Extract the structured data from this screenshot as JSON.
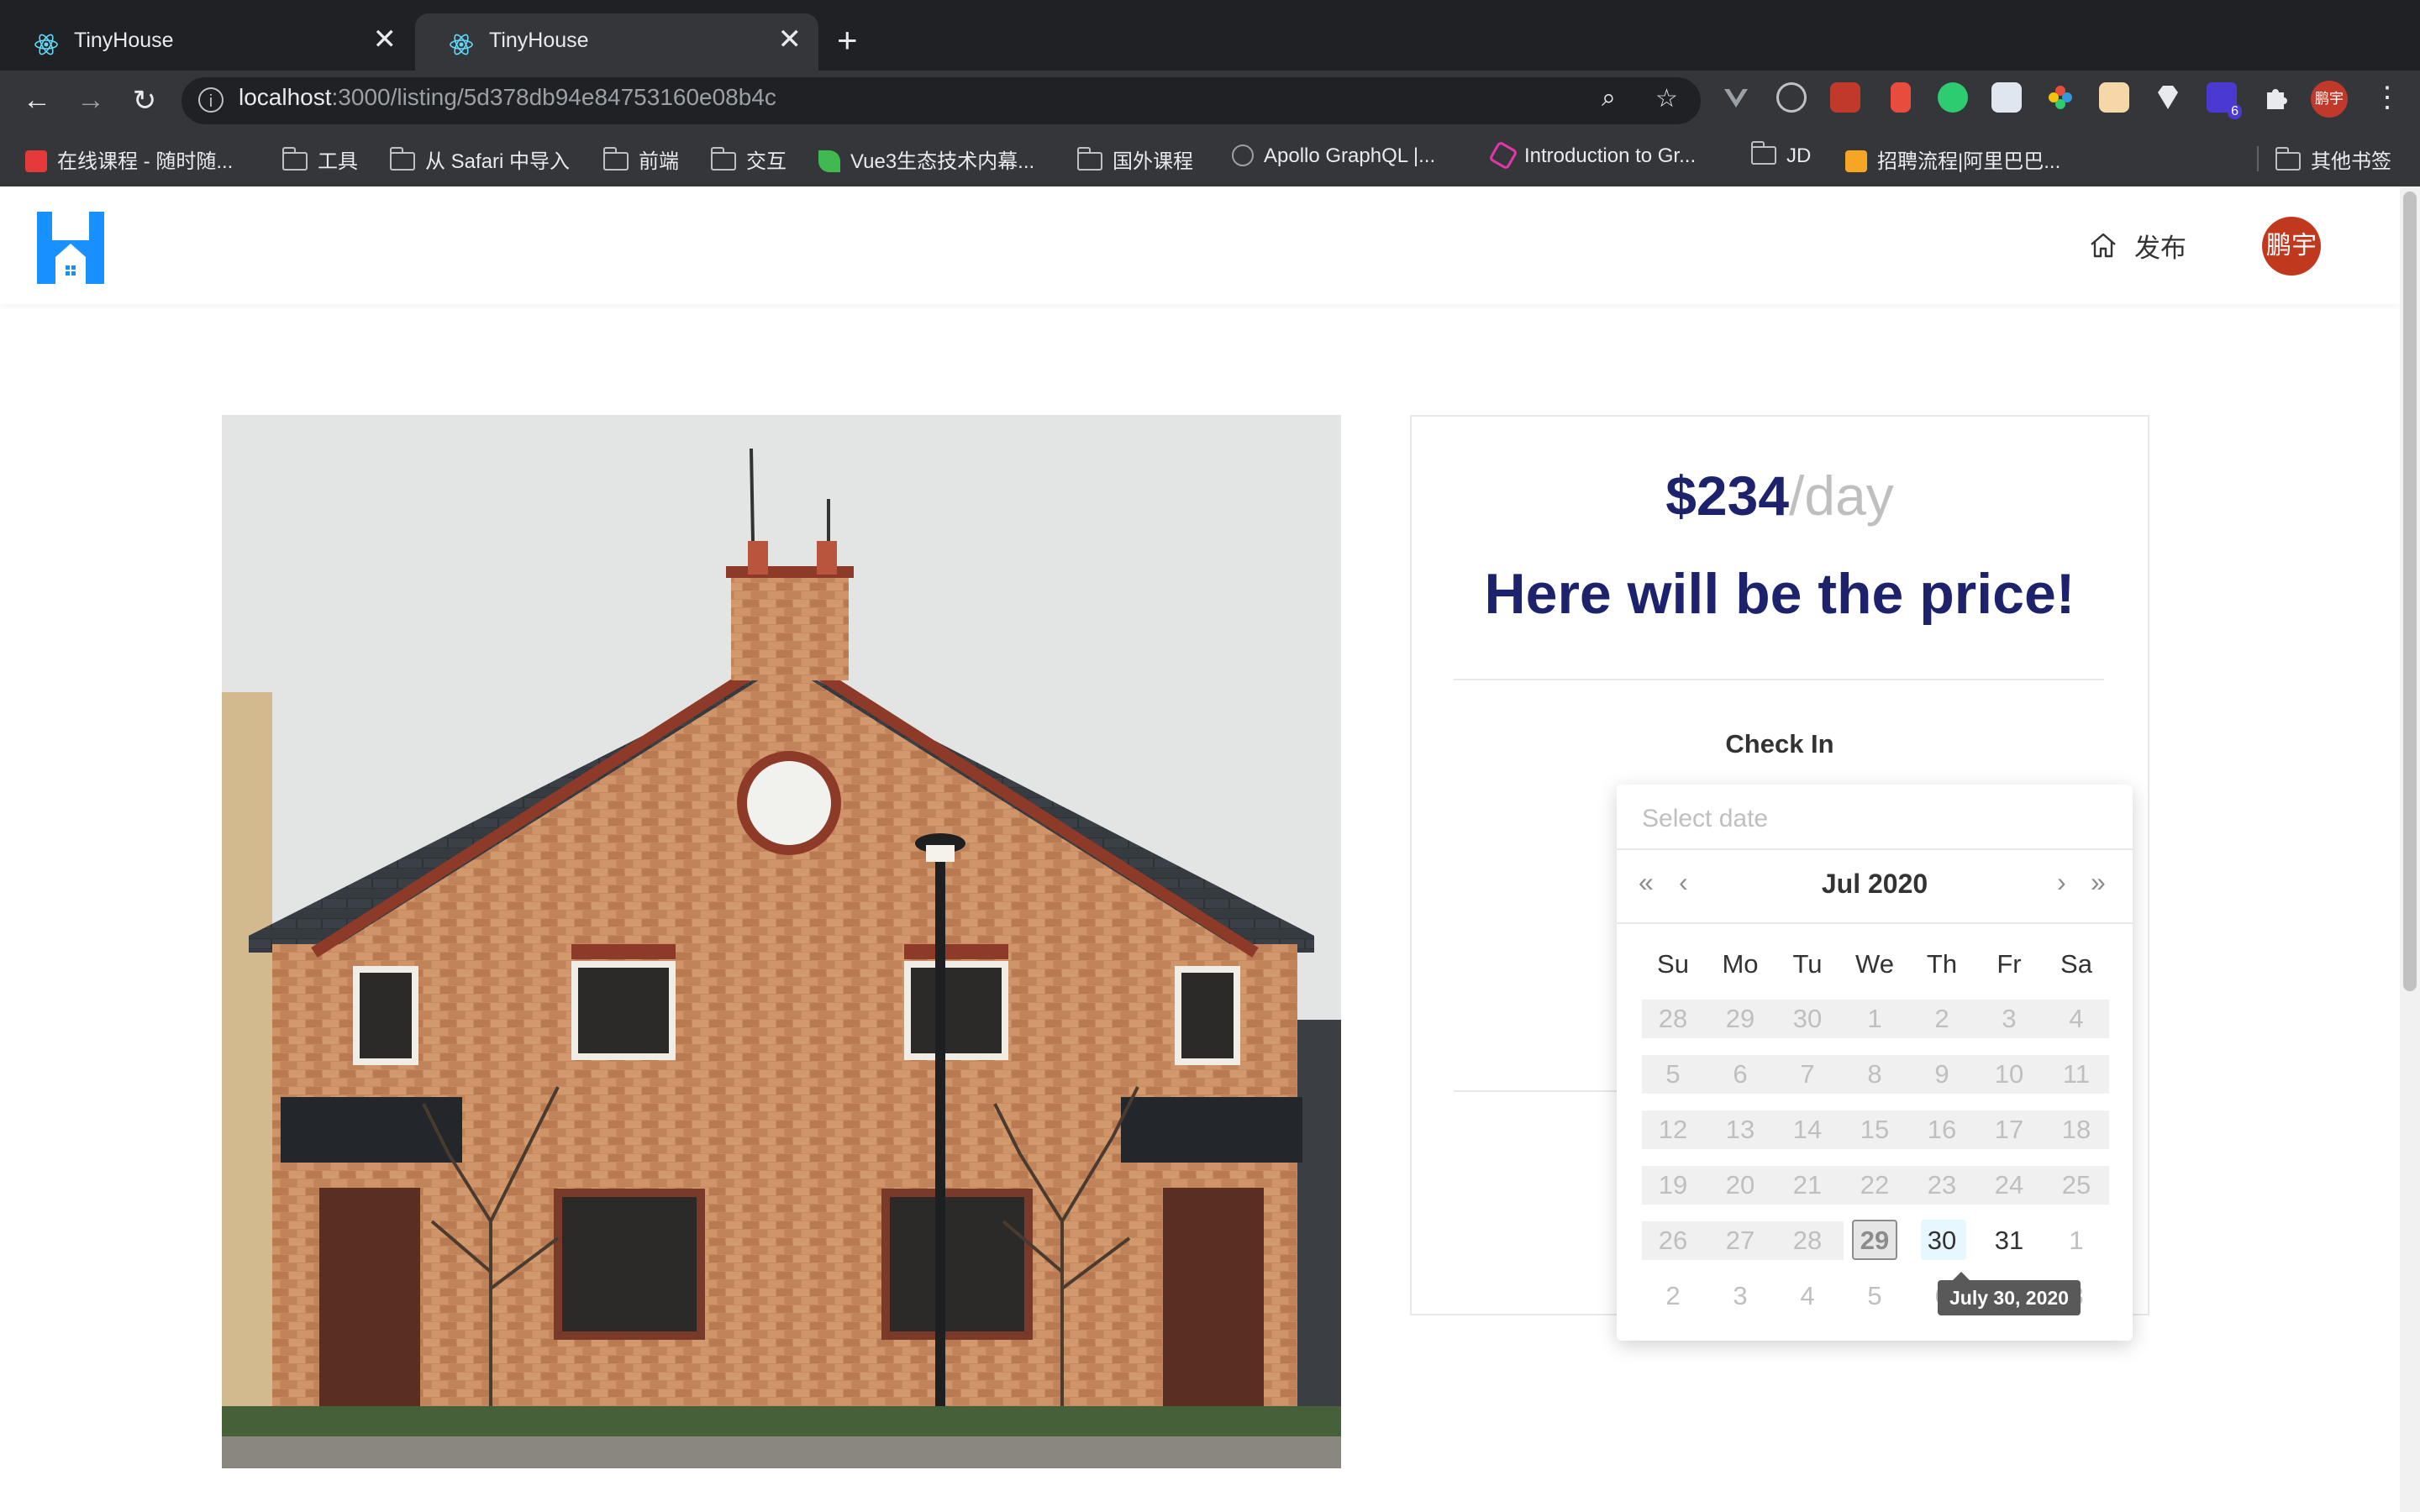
{
  "browser": {
    "tabs": [
      {
        "title": "TinyHouse",
        "close": "✕"
      },
      {
        "title": "TinyHouse",
        "close": "✕"
      }
    ],
    "new_tab": "+",
    "nav": {
      "back": "←",
      "forward": "→",
      "reload": "↻"
    },
    "url": {
      "host": "localhost",
      "rest": ":3000/listing/5d378db94e84753160e08b4c"
    },
    "url_info_icon": "i",
    "zoom_icon": "⌕",
    "star_icon": "☆",
    "profile_initials": "鹏宇",
    "menu": "⋮",
    "extension_badge": "6",
    "bookmarks": [
      {
        "label": "在线课程 - 随时随...",
        "icon": "brand-icon",
        "color": "#e5393a"
      },
      {
        "label": "工具",
        "icon": "folder-icon"
      },
      {
        "label": "从 Safari 中导入",
        "icon": "folder-icon"
      },
      {
        "label": "前端",
        "icon": "folder-icon"
      },
      {
        "label": "交互",
        "icon": "folder-icon"
      },
      {
        "label": "Vue3生态技术内幕...",
        "icon": "leaf-icon",
        "color": "#3fb950"
      },
      {
        "label": "国外课程",
        "icon": "folder-icon"
      },
      {
        "label": "Apollo GraphQL |...",
        "icon": "apollo-icon",
        "color": "#3c4a6b"
      },
      {
        "label": "Introduction to Gr...",
        "icon": "graphql-icon",
        "color": "#e535ab"
      },
      {
        "label": "JD",
        "icon": "folder-icon"
      },
      {
        "label": "招聘流程|阿里巴巴...",
        "icon": "alibaba-icon",
        "color": "#f5a623"
      },
      {
        "label": "其他书签",
        "icon": "folder-icon"
      }
    ]
  },
  "app": {
    "header": {
      "host_label": "发布",
      "avatar_text": "鹏宇"
    },
    "booking": {
      "price": "$234",
      "per": "/day",
      "price_title": "Here will be the price!",
      "check_in_label": "Check In"
    },
    "datepicker": {
      "placeholder": "Select date",
      "month_label": "Jul 2020",
      "prev_year": "«",
      "prev_month": "‹",
      "next_month": "›",
      "next_year": "»",
      "weekdays": [
        "Su",
        "Mo",
        "Tu",
        "We",
        "Th",
        "Fr",
        "Sa"
      ],
      "weeks": [
        [
          "28",
          "29",
          "30",
          "1",
          "2",
          "3",
          "4"
        ],
        [
          "5",
          "6",
          "7",
          "8",
          "9",
          "10",
          "11"
        ],
        [
          "12",
          "13",
          "14",
          "15",
          "16",
          "17",
          "18"
        ],
        [
          "19",
          "20",
          "21",
          "22",
          "23",
          "24",
          "25"
        ],
        [
          "26",
          "27",
          "28",
          "29",
          "30",
          "31",
          "1"
        ],
        [
          "2",
          "3",
          "4",
          "5",
          "6",
          "7",
          "8"
        ]
      ],
      "today": "29",
      "hovered": "30",
      "tooltip": "July 30, 2020"
    }
  },
  "colors": {
    "brand_navy": "#1d226c",
    "logo_blue": "#1890ff",
    "avatar_red": "#c0391f",
    "muted": "#bfbfbf"
  }
}
